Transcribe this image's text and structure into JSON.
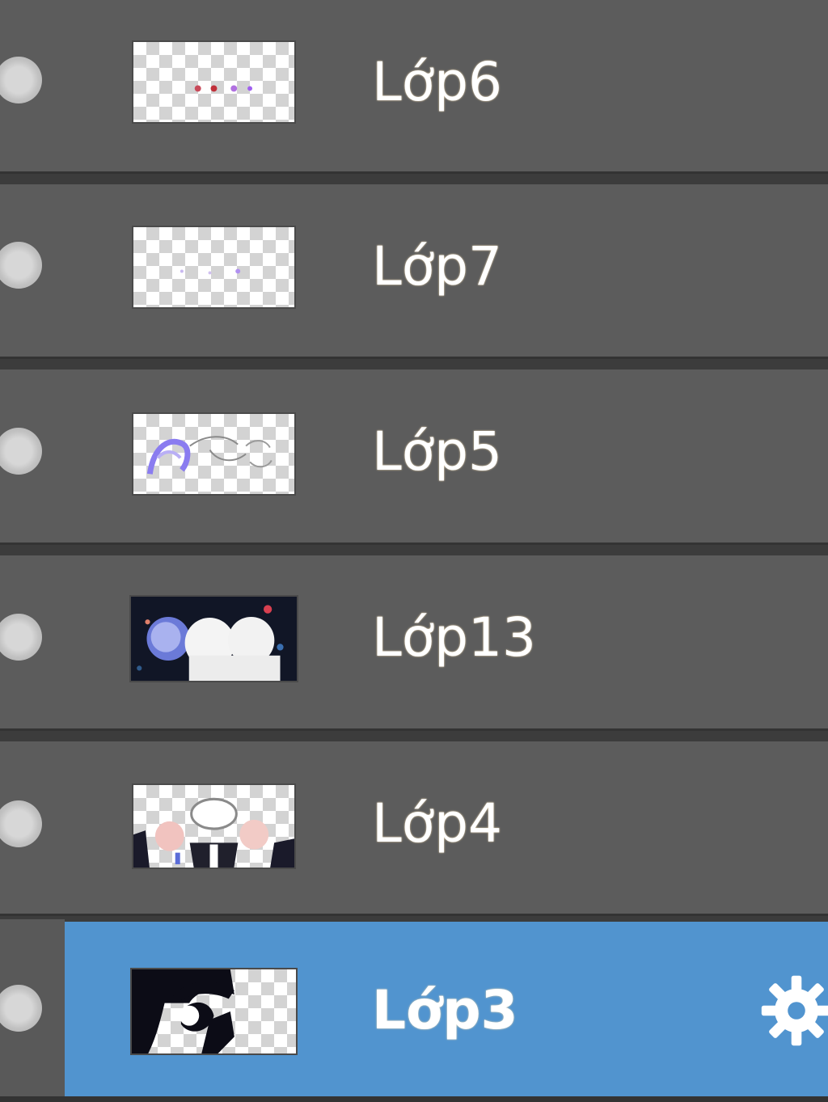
{
  "layers_panel": {
    "layers": [
      {
        "name": "Lớp6",
        "visible": true,
        "selected": false
      },
      {
        "name": "Lớp7",
        "visible": true,
        "selected": false
      },
      {
        "name": "Lớp5",
        "visible": true,
        "selected": false
      },
      {
        "name": "Lớp13",
        "visible": true,
        "selected": false
      },
      {
        "name": "Lớp4",
        "visible": true,
        "selected": false
      },
      {
        "name": "Lớp3",
        "visible": true,
        "selected": true
      }
    ],
    "icons": {
      "visibility": "visibility-toggle-icon",
      "settings": "gear-icon"
    },
    "colors": {
      "panel_bg": "#5c5c5c",
      "divider": "#333333",
      "selected_bg": "#5194cf",
      "text": "#ffffff"
    }
  }
}
